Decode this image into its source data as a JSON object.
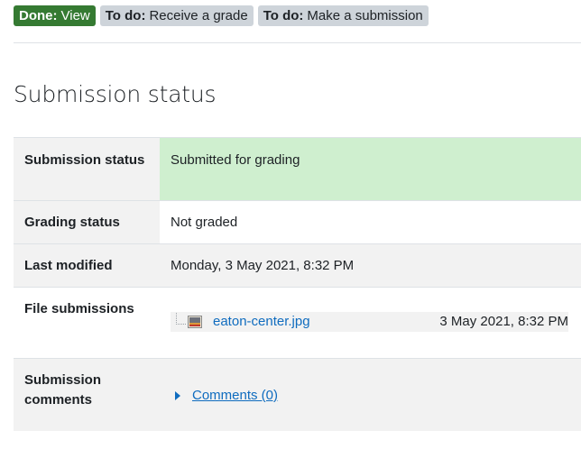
{
  "completion": {
    "done": {
      "prefix": "Done:",
      "label": "View"
    },
    "todo_grade": {
      "prefix": "To do:",
      "label": "Receive a grade"
    },
    "todo_submit": {
      "prefix": "To do:",
      "label": "Make a submission"
    }
  },
  "section_title": "Submission status",
  "rows": {
    "submission_status": {
      "label": "Submission status",
      "value": "Submitted for grading"
    },
    "grading_status": {
      "label": "Grading status",
      "value": "Not graded"
    },
    "last_modified": {
      "label": "Last modified",
      "value": "Monday, 3 May 2021, 8:32 PM"
    },
    "file_submissions": {
      "label": "File submissions",
      "files": [
        {
          "name": "eaton-center.jpg",
          "date": "3 May 2021, 8:32 PM",
          "icon": "image-file-icon"
        }
      ]
    },
    "submission_comments": {
      "label": "Submission comments",
      "toggle": "Comments (0)"
    }
  },
  "colors": {
    "done_badge": "#357a32",
    "todo_badge": "#ced4da",
    "submitted_bg": "#cfefcf",
    "link": "#0f6cbf"
  }
}
